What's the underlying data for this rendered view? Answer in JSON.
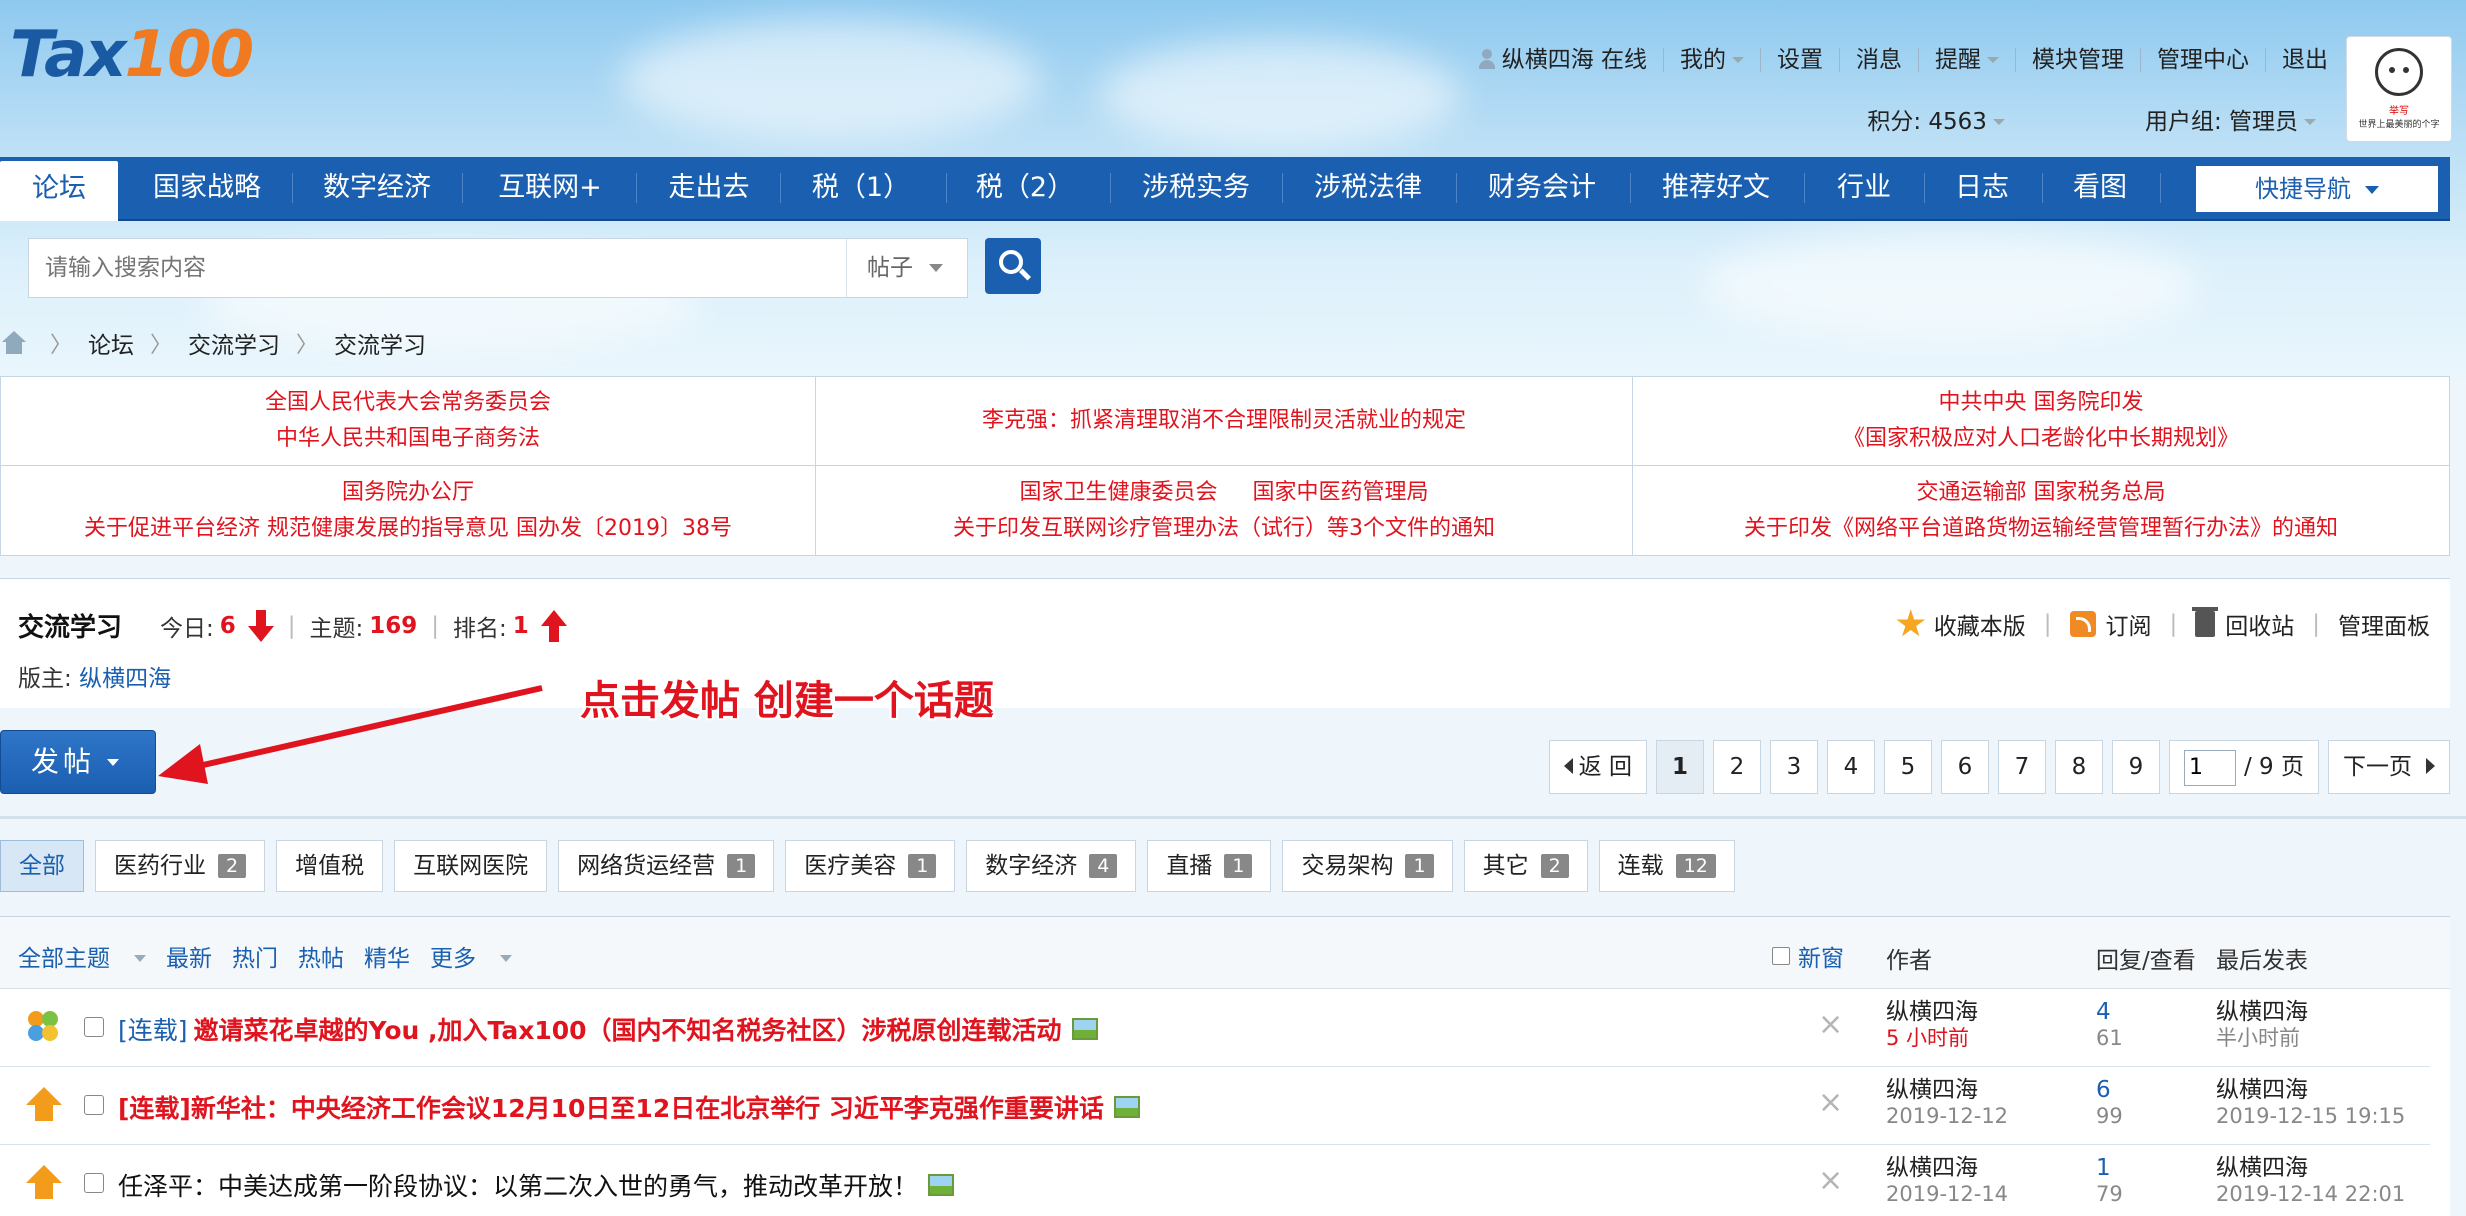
{
  "header": {
    "logo_part1": "Tax",
    "logo_part2": "100",
    "user_nav": [
      "纵横四海 在线",
      "我的",
      "设置",
      "消息",
      "提醒",
      "模块管理",
      "管理中心",
      "退出"
    ],
    "points": "积分: 4563",
    "user_group": "用户组: 管理员",
    "avatar_text1": "举写",
    "avatar_text2": "世界上最美丽的个字"
  },
  "nav": {
    "tabs": [
      "论坛",
      "国家战略",
      "数字经济",
      "互联网+",
      "走出去",
      "税（1）",
      "税（2）",
      "涉税实务",
      "涉税法律",
      "财务会计",
      "推荐好文",
      "行业",
      "日志",
      "看图"
    ],
    "quick_nav": "快捷导航"
  },
  "search": {
    "placeholder": "请输入搜索内容",
    "type": "帖子"
  },
  "breadcrumb": [
    "论坛",
    "交流学习",
    "交流学习"
  ],
  "notices": [
    [
      "全国人民代表大会常务委员会",
      "中华人民共和国电子商务法"
    ],
    [
      "李克强：抓紧清理取消不合理限制灵活就业的规定"
    ],
    [
      "中共中央 国务院印发",
      "《国家积极应对人口老龄化中长期规划》"
    ],
    [
      "国务院办公厅",
      "关于促进平台经济 规范健康发展的指导意见 国办发〔2019〕38号"
    ],
    [
      "国家卫生健康委员会     国家中医药管理局",
      "关于印发互联网诊疗管理办法（试行）等3个文件的通知"
    ],
    [
      "交通运输部 国家税务总局",
      "关于印发《网络平台道路货物运输经营管理暂行办法》的通知"
    ]
  ],
  "forum": {
    "title": "交流学习",
    "today_label": "今日:",
    "today": "6",
    "topics_label": "主题:",
    "topics": "169",
    "rank_label": "排名:",
    "rank": "1",
    "moderator_label": "版主: ",
    "moderator": "纵横四海",
    "actions": [
      "收藏本版",
      "订阅",
      "回收站",
      "管理面板"
    ]
  },
  "annotation": "点击发帖 创建一个话题",
  "post_button": "发帖",
  "pager": {
    "back": "返 回",
    "pages": [
      "1",
      "2",
      "3",
      "4",
      "5",
      "6",
      "7",
      "8",
      "9"
    ],
    "current": "1",
    "input_value": "1",
    "total": "/ 9 页",
    "next": "下一页"
  },
  "filters": [
    {
      "label": "全部",
      "count": ""
    },
    {
      "label": "医药行业",
      "count": "2"
    },
    {
      "label": "增值税",
      "count": ""
    },
    {
      "label": "互联网医院",
      "count": ""
    },
    {
      "label": "网络货运经营",
      "count": "1"
    },
    {
      "label": "医疗美容",
      "count": "1"
    },
    {
      "label": "数字经济",
      "count": "4"
    },
    {
      "label": "直播",
      "count": "1"
    },
    {
      "label": "交易架构",
      "count": "1"
    },
    {
      "label": "其它",
      "count": "2"
    },
    {
      "label": "连载",
      "count": "12"
    }
  ],
  "list_head": {
    "all": "全部主题",
    "links": [
      "最新",
      "热门",
      "热帖",
      "精华",
      "更多"
    ],
    "new_window": "新窗",
    "author": "作者",
    "replies_views": "回复/查看",
    "last_post": "最后发表"
  },
  "threads": [
    {
      "tag": "[连载]",
      "title": "邀请菜花卓越的You ,加入Tax100（国内不知名税务社区）涉税原创连载活动",
      "style": "red",
      "author": "纵横四海",
      "date": "5 小时前",
      "replies": "4",
      "views": "61",
      "last_user": "纵横四海",
      "last_time": "半小时前"
    },
    {
      "tag": "",
      "title": "[连载]新华社：中央经济工作会议12月10日至12日在北京举行 习近平李克强作重要讲话",
      "style": "red",
      "author": "纵横四海",
      "date": "2019-12-12",
      "replies": "6",
      "views": "99",
      "last_user": "纵横四海",
      "last_time": "2019-12-15 19:15"
    },
    {
      "tag": "",
      "title": "任泽平：中美达成第一阶段协议：以第二次入世的勇气，推动改革开放！",
      "style": "plain",
      "author": "纵横四海",
      "date": "2019-12-14",
      "replies": "1",
      "views": "79",
      "last_user": "纵横四海",
      "last_time": "2019-12-14 22:01"
    }
  ],
  "colors": {
    "brand": "#1a5fb0",
    "accent": "#e0141e",
    "logo_orange": "#f07a22"
  }
}
